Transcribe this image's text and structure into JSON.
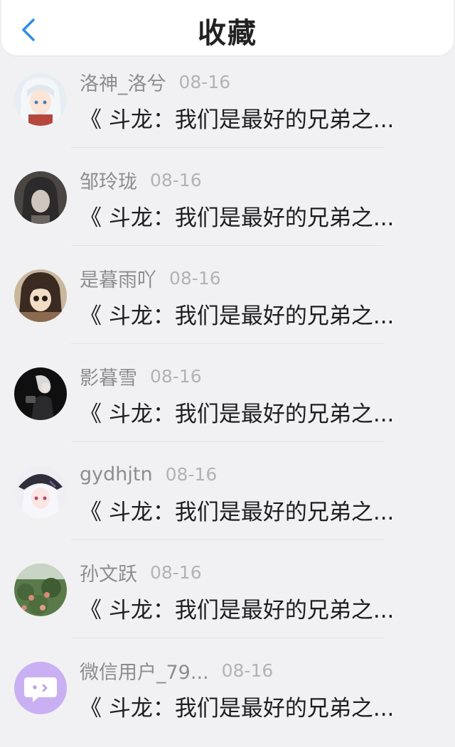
{
  "header": {
    "title": "收藏",
    "back_icon": "chevron-left-icon"
  },
  "colors": {
    "accent": "#2f8ee5",
    "background": "#f1f1f3",
    "username": "#8d8d8d",
    "date": "#b3b3b3"
  },
  "items": [
    {
      "user": "洛神_洛兮",
      "date": "08-16",
      "text": "《 斗龙：我们是最好的兄弟之..."
    },
    {
      "user": "邹玲珑",
      "date": "08-16",
      "text": "《 斗龙：我们是最好的兄弟之..."
    },
    {
      "user": "是暮雨吖",
      "date": "08-16",
      "text": "《 斗龙：我们是最好的兄弟之..."
    },
    {
      "user": "影暮雪",
      "date": "08-16",
      "text": "《 斗龙：我们是最好的兄弟之..."
    },
    {
      "user": "gydhjtn",
      "date": "08-16",
      "text": "《 斗龙：我们是最好的兄弟之..."
    },
    {
      "user": "孙文跃",
      "date": "08-16",
      "text": "《 斗龙：我们是最好的兄弟之..."
    },
    {
      "user": "微信用户_79...",
      "date": "08-16",
      "text": "《 斗龙：我们是最好的兄弟之..."
    }
  ]
}
